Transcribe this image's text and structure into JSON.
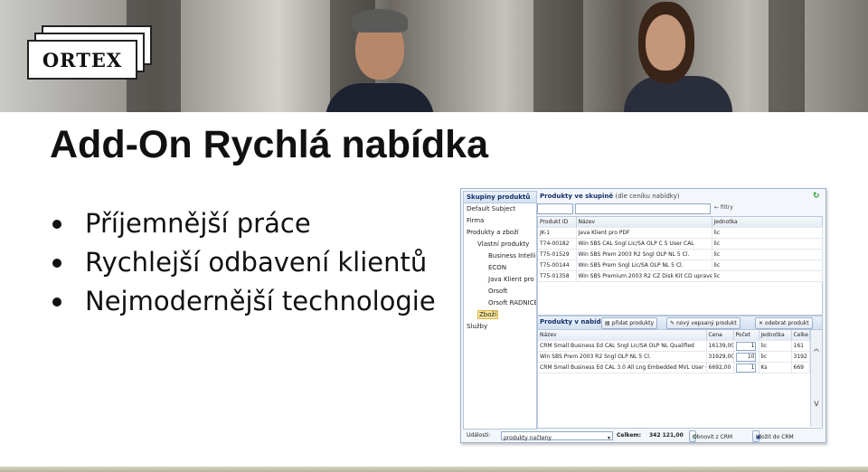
{
  "logo": {
    "text": "ORTEX"
  },
  "title": "Add-On Rychlá nabídka",
  "bullets": [
    "Příjemnější práce",
    "Rychlejší odbavení klientů",
    "Nejmodernější technologie"
  ],
  "app": {
    "left_panel": {
      "title": "Skupiny produktů",
      "items": [
        "Default Subject",
        "Firma",
        "Produkty a zboží",
        "Vlastní produkty",
        "Business Intelli",
        "ECON",
        "Java Klient pro",
        "Orsoft",
        "Orsoft RADNICE",
        "Zboží",
        "Služby"
      ]
    },
    "products": {
      "title": "Produkty ve skupině",
      "subtitle": "(dle ceníku nabídky)",
      "filters": "← filtry",
      "columns": [
        "Produkt ID",
        "Název",
        "Jednotka"
      ],
      "rows": [
        [
          "JK-1",
          "Java Klient pro PDF",
          "lic"
        ],
        [
          "T74-00182",
          "Win SBS CAL Sngl Lic/SA OLP C 5 User CAL",
          "lic"
        ],
        [
          "T75-01529",
          "Win SBS Prem 2003 R2 Sngl OLP NL 5 Cl.",
          "lic"
        ],
        [
          "T75-00144",
          "Win SBS Prem Sngl Lic/SA OLP NL 5 Cl.",
          "lic"
        ],
        [
          "T75-01358",
          "Win SBS Premium 2003 R2 CZ Disk Kit CD upraveno",
          "lic"
        ]
      ]
    },
    "offer": {
      "title": "Produkty v nabídce",
      "buttons": {
        "add": "přidat produkty",
        "new": "nový vepsaný produkt",
        "remove": "odebrat produkt"
      },
      "columns": [
        "Název",
        "Cena",
        "Počet",
        "Jednotka",
        "Celke"
      ],
      "rows": [
        [
          "CRM Small Business Ed CAL Sngl Lic/SA OLP NL Qualified",
          "16139,00",
          "1",
          "lic",
          "161"
        ],
        [
          "Win SBS Prem 2003 R2 Sngl OLP NL 5 Cl.",
          "31929,00",
          "10",
          "lic",
          "3192"
        ],
        [
          "CRM Small Business Ed CAL 3.0 All Lng Embedded MVL User CAL",
          "6692,00",
          "1",
          "Ks",
          "669"
        ]
      ],
      "scroll_up": "^",
      "scroll_down": "v"
    },
    "footer": {
      "events_label": "Události:",
      "events_value": "produkty načteny",
      "total_label": "Celkem:",
      "total_value": "342 121,00",
      "refresh_button": "Obnovit z CRM",
      "save_button": "Uložit do CRM"
    }
  }
}
